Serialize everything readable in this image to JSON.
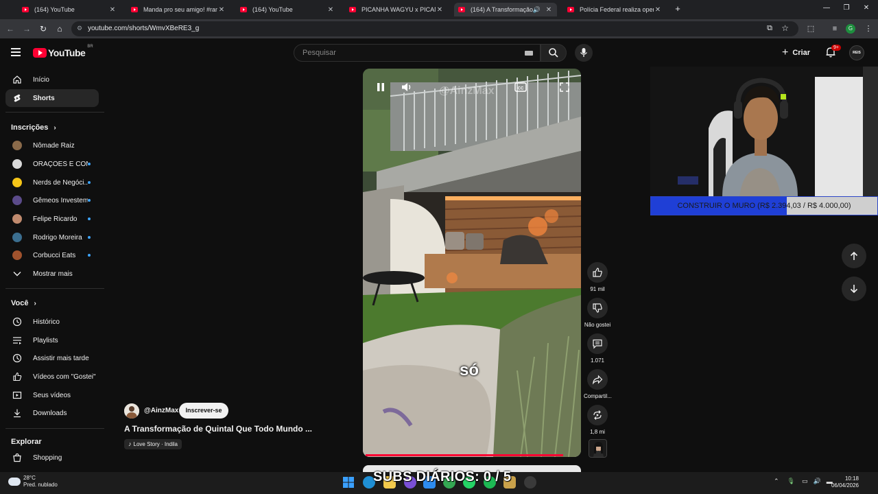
{
  "browser": {
    "tabs": [
      {
        "title": "(164) YouTube",
        "active": false
      },
      {
        "title": "Manda pro seu amigo! #ram #carros",
        "active": false
      },
      {
        "title": "(164) YouTube",
        "active": false
      },
      {
        "title": "PICANHA WAGYU x PICANHA COMUM",
        "active": false
      },
      {
        "title": "(164) A Transformação de Quintal",
        "active": true
      },
      {
        "title": "Polícia Federal realiza operação",
        "active": false
      }
    ],
    "url": "youtube.com/shorts/WmvXBeRE3_g"
  },
  "header": {
    "logo_text": "YouTube",
    "country_code": "BR",
    "search_placeholder": "Pesquisar",
    "create_label": "Criar",
    "notification_badge": "9+",
    "avatar_text": "REIS"
  },
  "sidebar": {
    "main": [
      {
        "label": "Início",
        "icon": "home-icon"
      },
      {
        "label": "Shorts",
        "icon": "shorts-icon",
        "active": true
      }
    ],
    "subscriptions_header": "Inscrições",
    "subscriptions": [
      {
        "label": "Nômade Raiz",
        "color": "#8a6a4a",
        "new": false
      },
      {
        "label": "ORAÇÕES E CON...",
        "color": "#d9d9d9",
        "new": true
      },
      {
        "label": "Nerds de Negóci...",
        "color": "#f5c518",
        "new": true
      },
      {
        "label": "Gêmeos Investem",
        "color": "#5b4b8a",
        "new": true
      },
      {
        "label": "Felipe Ricardo",
        "color": "#c08a6e",
        "new": true
      },
      {
        "label": "Rodrigo Moreira",
        "color": "#3b6e8f",
        "new": true
      },
      {
        "label": "Corbucci Eats",
        "color": "#a0522d",
        "new": true
      }
    ],
    "show_more": "Mostrar mais",
    "you_header": "Você",
    "you": [
      {
        "label": "Histórico",
        "icon": "history-icon"
      },
      {
        "label": "Playlists",
        "icon": "playlists-icon"
      },
      {
        "label": "Assistir mais tarde",
        "icon": "watch-later-icon"
      },
      {
        "label": "Vídeos com \"Gostei\"",
        "icon": "liked-icon"
      },
      {
        "label": "Seus vídeos",
        "icon": "your-videos-icon"
      },
      {
        "label": "Downloads",
        "icon": "downloads-icon"
      }
    ],
    "explore_header": "Explorar",
    "explore": [
      {
        "label": "Shopping",
        "icon": "shopping-icon"
      }
    ]
  },
  "short": {
    "watermark": "@AinzMax",
    "caption": "só",
    "channel": "@AinzMax",
    "subscribe_label": "Inscrever-se",
    "title": "A Transformação de Quintal Que Todo Mundo ...",
    "music": "Love Story · Indila",
    "progress": 0.93,
    "actions": {
      "likes": "91 mil",
      "dislike_label": "Não gostei",
      "comments": "1.071",
      "share_label": "Compartil...",
      "remix": "1,8 mi"
    }
  },
  "stream_overlay": {
    "goal_text": "CONSTRUIR O MURO (R$ 2.394,03 / R$ 4.000,00)",
    "goal_current": 2394.03,
    "goal_target": 4000.0,
    "goal_fill_color": "#1f3fd6",
    "subs_text": "SUBS DIÁRIOS: 0 / 5"
  },
  "taskbar": {
    "temperature": "28°C",
    "weather": "Pred. nublado",
    "time": "10:18",
    "date": "06/04/2026"
  }
}
